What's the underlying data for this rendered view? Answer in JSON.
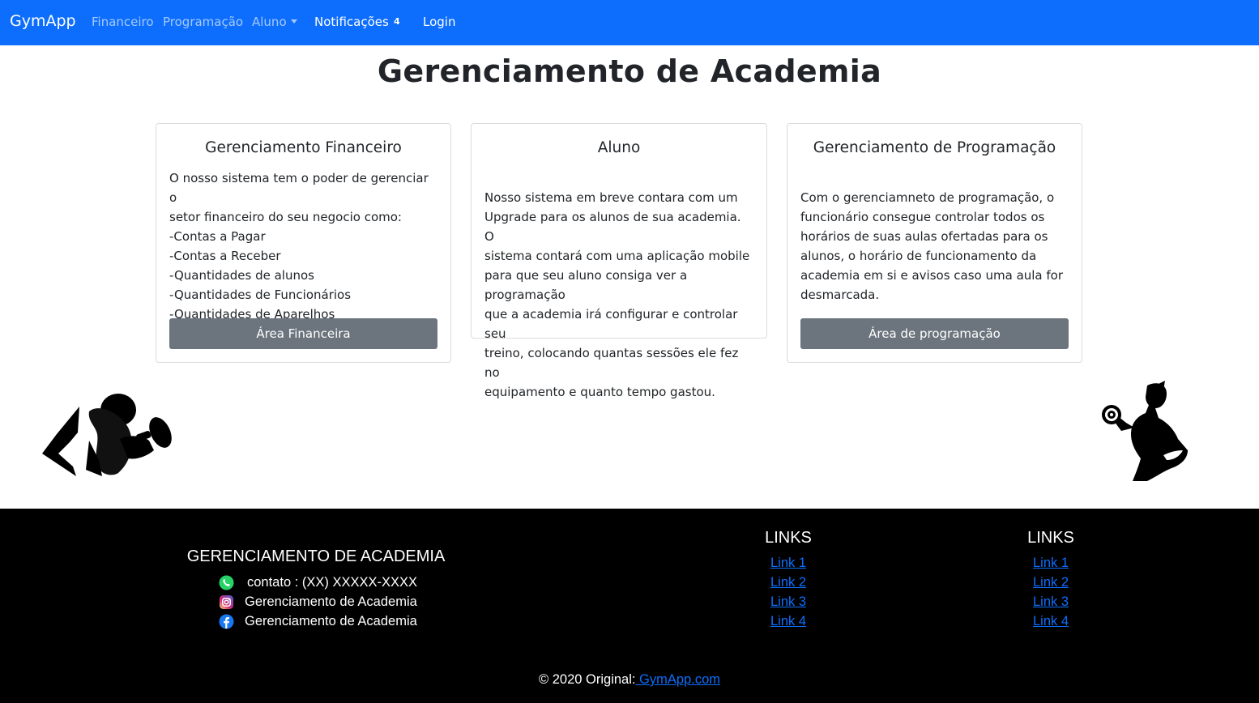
{
  "navbar": {
    "brand": "GymApp",
    "items": [
      {
        "label": "Financeiro"
      },
      {
        "label": "Programação"
      },
      {
        "label": "Aluno"
      },
      {
        "label": "Notificações"
      },
      {
        "label": "Login"
      }
    ],
    "notification_count": "4",
    "colors": {
      "background": "#0d6efd"
    }
  },
  "page": {
    "title": "Gerenciamento de Academia"
  },
  "cards": [
    {
      "title": "Gerenciamento Financeiro",
      "lines": [
        "O nosso sistema tem o poder de gerenciar o",
        "setor financeiro do seu negocio como:",
        "-Contas a Pagar",
        "-Contas a Receber",
        "-Quantidades de alunos",
        "-Quantidades de Funcionários",
        "-Quantidades de Aparelhos"
      ],
      "button": "Área Financeira"
    },
    {
      "title": "Aluno",
      "lines": [
        "Nosso sistema em breve contara com um",
        "Upgrade para os alunos de sua academia. O",
        "sistema contará com uma aplicação mobile",
        "para que seu aluno consiga ver a programação",
        "que a academia irá configurar e controlar seu",
        "treino, colocando quantas sessões ele fez no",
        "equipamento e quanto tempo gastou."
      ]
    },
    {
      "title": "Gerenciamento de Programação",
      "lines": [
        "Com o gerenciamneto de programação, o",
        "funcionário consegue controlar todos os",
        "horários de suas aulas ofertadas para os",
        "alunos, o horário de funcionamento da",
        "academia em si e avisos caso uma aula for",
        "desmarcada."
      ],
      "button": "Área de programação"
    }
  ],
  "footer": {
    "title": "GERENCIAMENTO DE ACADEMIA",
    "contacts": [
      {
        "icon": "whatsapp-icon",
        "text": "contato : (XX) XXXXX-XXXX"
      },
      {
        "icon": "instagram-icon",
        "text": "Gerenciamento de Academia"
      },
      {
        "icon": "facebook-icon",
        "text": "Gerenciamento de Academia"
      }
    ],
    "link_columns": [
      {
        "heading": "LINKS",
        "links": [
          "Link 1",
          "Link 2",
          "Link 3",
          "Link 4"
        ]
      },
      {
        "heading": "LINKS",
        "links": [
          "Link 1",
          "Link 2",
          "Link 3",
          "Link 4"
        ]
      }
    ],
    "copyright_prefix": "© 2020 Original:",
    "copyright_link": " GymApp.com",
    "colors": {
      "background": "#000000",
      "link": "#0d6efd"
    }
  },
  "images": {
    "left": "man-lifting-dumbbell-silhouette",
    "right": "woman-holding-dumbbell-silhouette"
  }
}
